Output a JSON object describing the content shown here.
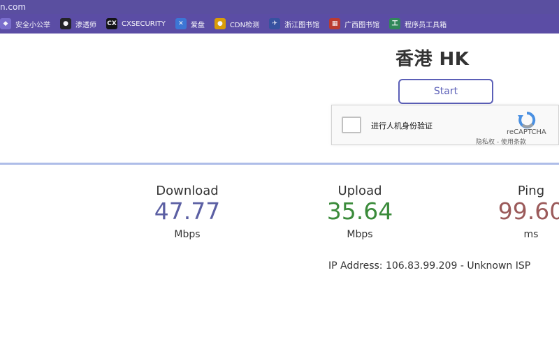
{
  "browser": {
    "url_fragment": "n.com",
    "bookmarks": [
      {
        "icon": "shield-icon",
        "label": "安全小公举",
        "icon_color": "#5b4da5",
        "glyph": "◆"
      },
      {
        "icon": "penguin-icon",
        "label": "渗透师",
        "icon_color": "#222222",
        "glyph": "●"
      },
      {
        "icon": "cx-icon",
        "label": "CXSECURITY",
        "icon_color": "#111111",
        "glyph": "CX"
      },
      {
        "icon": "panda-icon",
        "label": "爱盘",
        "icon_color": "#3b79d8",
        "glyph": "✕"
      },
      {
        "icon": "lock-icon",
        "label": "CDN检测",
        "icon_color": "#e0a100",
        "glyph": "●"
      },
      {
        "icon": "bird-icon",
        "label": "浙江图书馆",
        "icon_color": "#3653a0",
        "glyph": "✈"
      },
      {
        "icon": "library-icon",
        "label": "广西图书馆",
        "icon_color": "#c0392b",
        "glyph": "▦"
      },
      {
        "icon": "toolbox-icon",
        "label": "程序员工具箱",
        "icon_color": "#2e8b57",
        "glyph": "工"
      }
    ]
  },
  "server": {
    "title": "香港 HK"
  },
  "controls": {
    "start_label": "Start"
  },
  "recaptcha": {
    "label": "进行人机身份验证",
    "brand": "reCAPTCHA",
    "privacy": "隐私权 - 使用条款"
  },
  "results": {
    "download": {
      "label": "Download",
      "value": "47.77",
      "unit": "Mbps"
    },
    "upload": {
      "label": "Upload",
      "value": "35.64",
      "unit": "Mbps"
    },
    "ping": {
      "label": "Ping",
      "value": "99.60",
      "unit": "ms"
    }
  },
  "ip_info": "IP Address: 106.83.99.209 - Unknown ISP",
  "colors": {
    "accent": "#5b5fb7",
    "download": "#5b5fa3",
    "upload": "#3b8b3b",
    "ping": "#9b5a5a"
  }
}
